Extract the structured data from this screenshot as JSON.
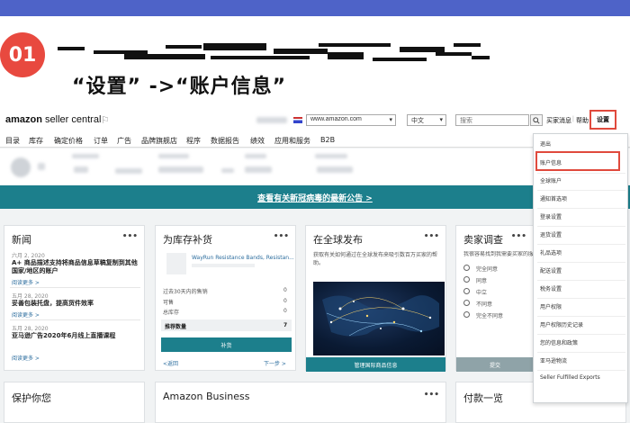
{
  "slide": {
    "step_number": "01",
    "instruction": "“设置” ->“账户信息”"
  },
  "header": {
    "logo_main": "amazon",
    "logo_sub": " seller central",
    "marketplace": "www.amazon.com",
    "language": "中文",
    "search_placeholder": "搜索",
    "buyer_messages": "买家消息",
    "help": "帮助",
    "settings": "设置"
  },
  "nav": {
    "items": [
      "目录",
      "库存",
      "确定价格",
      "订单",
      "广告",
      "品牌旗舰店",
      "程序",
      "数据报告",
      "绩效",
      "应用和服务",
      "B2B"
    ]
  },
  "banner": {
    "link": "查看有关新冠病毒的最新公告 >"
  },
  "cards": {
    "news": {
      "title": "新闻",
      "more": "•••",
      "items": [
        {
          "date": "六月 2, 2020",
          "title": "A+ 商品描述支持将商品信息草稿复制到其他国家/地区的账户",
          "link": "阅读更多 >"
        },
        {
          "date": "五月 28, 2020",
          "title": "妥善包装托盘，提高货件效率",
          "link": "阅读更多 >"
        },
        {
          "date": "五月 28, 2020",
          "title": "亚马逊广告2020年6月线上直播课程",
          "link": "阅读更多 >"
        }
      ]
    },
    "restock": {
      "title": "为库存补货",
      "more": "•••",
      "product": "WayRun Resistance Bands, Resistan...",
      "rows": [
        {
          "label": "过去30天内的售销",
          "value": "0"
        },
        {
          "label": "可售",
          "value": "0"
        },
        {
          "label": "总库存",
          "value": "0"
        }
      ],
      "recommended_label": "推荐数量",
      "recommended_value": "7",
      "button": "补货",
      "prev": "<返回",
      "next": "下一步 >"
    },
    "global": {
      "title": "在全球发布",
      "more": "•••",
      "desc": "获取有关如何通过在全球发布来吸引数百万买家的帮助。",
      "button": "管理国际商品信息"
    },
    "survey": {
      "title": "卖家调查",
      "more": "•••",
      "question": "我很容易找到我需要买家的服务",
      "options": [
        "完全同意",
        "同意",
        "中立",
        "不同意",
        "完全不同意"
      ],
      "submit": "提交"
    }
  },
  "bottom": {
    "card1_title": "保护你您",
    "card2_title": "Amazon Business",
    "card3_title": "付款一览"
  },
  "dropdown": {
    "items": [
      "退出",
      "账户信息",
      "全球账户",
      "通知首选项",
      "登录设置",
      "退货设置",
      "礼品选项",
      "配送设置",
      "税务设置",
      "用户权限",
      "用户权限历史记录",
      "您的信息和政策",
      "亚马逊物流",
      "Seller Fulfilled Exports"
    ]
  }
}
